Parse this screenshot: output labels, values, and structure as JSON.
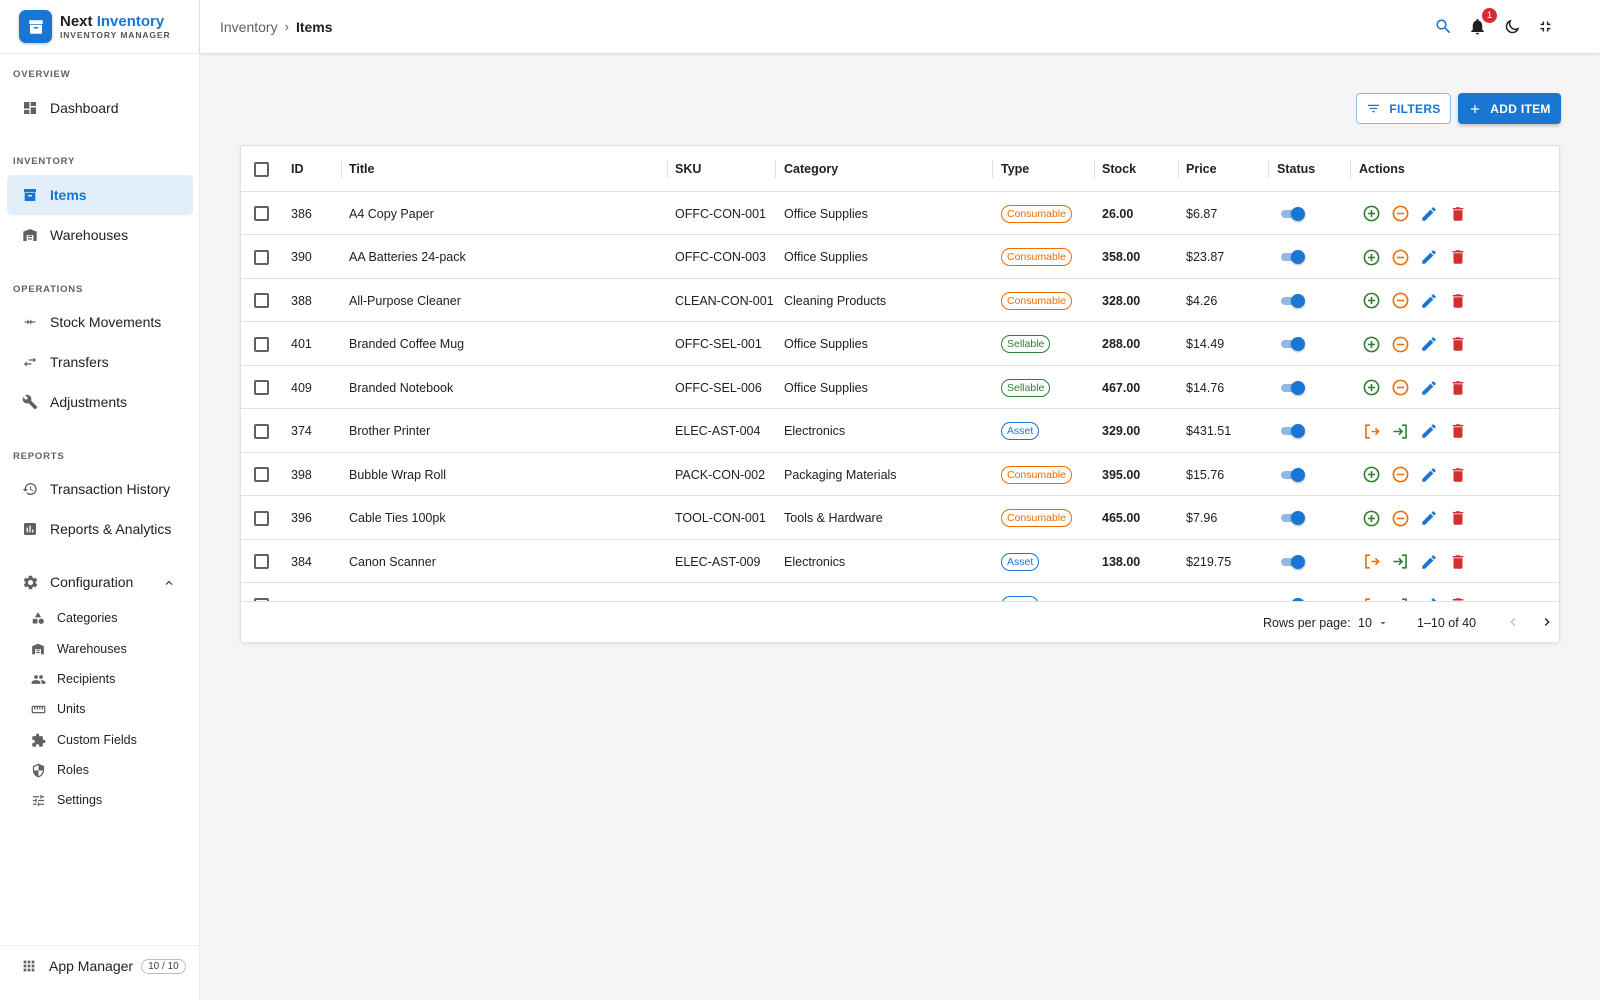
{
  "app": {
    "name_part1": "Next",
    "name_part2": "Inventory",
    "subtitle": "INVENTORY MANAGER"
  },
  "colors": {
    "primary": "#1976d2",
    "consumable": "#ef6c00",
    "sellable": "#2e7d32",
    "asset": "#1976d2",
    "danger": "#d32f2f"
  },
  "sidebar": {
    "sections": {
      "overview": "OVERVIEW",
      "inventory": "INVENTORY",
      "operations": "OPERATIONS",
      "reports": "REPORTS"
    },
    "items": {
      "dashboard": "Dashboard",
      "items": "Items",
      "warehouses": "Warehouses",
      "stock_movements": "Stock Movements",
      "transfers": "Transfers",
      "adjustments": "Adjustments",
      "transaction_history": "Transaction History",
      "reports_analytics": "Reports & Analytics",
      "configuration": "Configuration"
    },
    "config_items": {
      "categories": "Categories",
      "warehouses": "Warehouses",
      "recipients": "Recipients",
      "units": "Units",
      "custom_fields": "Custom Fields",
      "roles": "Roles",
      "settings": "Settings"
    },
    "app_manager": {
      "label": "App Manager",
      "badge": "10 / 10"
    }
  },
  "header": {
    "breadcrumb": {
      "parent": "Inventory",
      "separator": "›",
      "current": "Items"
    },
    "notification_count": "1"
  },
  "toolbar": {
    "filters_label": "FILTERS",
    "add_label": "ADD ITEM"
  },
  "table": {
    "columns": {
      "id": "ID",
      "title": "Title",
      "sku": "SKU",
      "category": "Category",
      "type": "Type",
      "stock": "Stock",
      "price": "Price",
      "status": "Status",
      "actions": "Actions"
    },
    "rows": [
      {
        "id": "386",
        "title": "A4 Copy Paper",
        "sku": "OFFC-CON-001",
        "category": "Office Supplies",
        "type": "Consumable",
        "stock": "26.00",
        "price": "$6.87",
        "active": true
      },
      {
        "id": "390",
        "title": "AA Batteries 24-pack",
        "sku": "OFFC-CON-003",
        "category": "Office Supplies",
        "type": "Consumable",
        "stock": "358.00",
        "price": "$23.87",
        "active": true
      },
      {
        "id": "388",
        "title": "All-Purpose Cleaner",
        "sku": "CLEAN-CON-001",
        "category": "Cleaning Products",
        "type": "Consumable",
        "stock": "328.00",
        "price": "$4.26",
        "active": true
      },
      {
        "id": "401",
        "title": "Branded Coffee Mug",
        "sku": "OFFC-SEL-001",
        "category": "Office Supplies",
        "type": "Sellable",
        "stock": "288.00",
        "price": "$14.49",
        "active": true
      },
      {
        "id": "409",
        "title": "Branded Notebook",
        "sku": "OFFC-SEL-006",
        "category": "Office Supplies",
        "type": "Sellable",
        "stock": "467.00",
        "price": "$14.76",
        "active": true
      },
      {
        "id": "374",
        "title": "Brother Printer",
        "sku": "ELEC-AST-004",
        "category": "Electronics",
        "type": "Asset",
        "stock": "329.00",
        "price": "$431.51",
        "active": true
      },
      {
        "id": "398",
        "title": "Bubble Wrap Roll",
        "sku": "PACK-CON-002",
        "category": "Packaging Materials",
        "type": "Consumable",
        "stock": "395.00",
        "price": "$15.76",
        "active": true
      },
      {
        "id": "396",
        "title": "Cable Ties 100pk",
        "sku": "TOOL-CON-001",
        "category": "Tools & Hardware",
        "type": "Consumable",
        "stock": "465.00",
        "price": "$7.96",
        "active": true
      },
      {
        "id": "384",
        "title": "Canon Scanner",
        "sku": "ELEC-AST-009",
        "category": "Electronics",
        "type": "Asset",
        "stock": "138.00",
        "price": "$219.75",
        "active": true
      },
      {
        "id": "",
        "title": "",
        "sku": "",
        "category": "",
        "type": "Asset",
        "stock": "",
        "price": "",
        "active": true
      }
    ],
    "footer": {
      "rows_per_page_label": "Rows per page:",
      "rows_per_page": "10",
      "range": "1–10 of 40"
    }
  }
}
